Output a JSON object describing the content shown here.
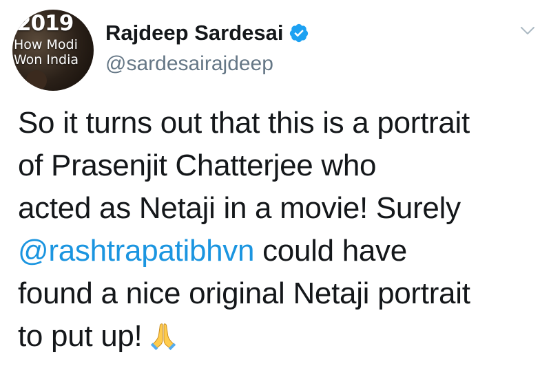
{
  "avatar": {
    "year": "2019",
    "line1": "How Modi",
    "line2": "Won India"
  },
  "user": {
    "display_name": "Rajdeep Sardesai",
    "handle": "@sardesairajdeep",
    "verified_icon": "verified-badge-icon"
  },
  "menu": {
    "icon": "chevron-down-icon"
  },
  "tweet": {
    "line1": "So it turns out that this is a portrait",
    "line2": "of Prasenjit Chatterjee who",
    "line3": "acted as Netaji in a movie! Surely",
    "mention": "@rashtrapatibhvn",
    "line4_rest": " could have",
    "line5": "found a nice original Netaji portrait",
    "line6": "to put up!",
    "emoji_icon": "folded-hands-icon"
  },
  "colors": {
    "text": "#14171a",
    "secondary": "#657786",
    "link": "#1b95e0",
    "verified": "#1da1f2"
  }
}
